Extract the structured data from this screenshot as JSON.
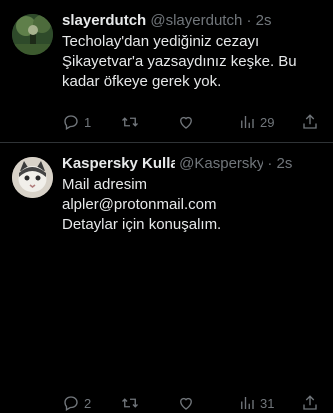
{
  "tweets": [
    {
      "name": "slayerdutch",
      "handle": "@slayerdutch",
      "dot": "·",
      "time": "2s",
      "text": "Techolay'dan yediğiniz cezayı Şikayetvar'a yazsaydınız keşke. Bu kadar öfkeye gerek yok.",
      "replies": "1",
      "views": "29",
      "icons": [
        "reply-icon",
        "retweet-icon",
        "like-icon",
        "views-icon",
        "share-icon"
      ]
    },
    {
      "name": "Kaspersky Kulla",
      "handle": "@Kaspersky",
      "dot": "·",
      "time": "2s",
      "text": "Mail adresim\nalpler@protonmail.com\nDetaylar için konuşalım.",
      "replies": "2",
      "views": "31",
      "icons": [
        "reply-icon",
        "retweet-icon",
        "like-icon",
        "views-icon",
        "share-icon"
      ]
    }
  ]
}
